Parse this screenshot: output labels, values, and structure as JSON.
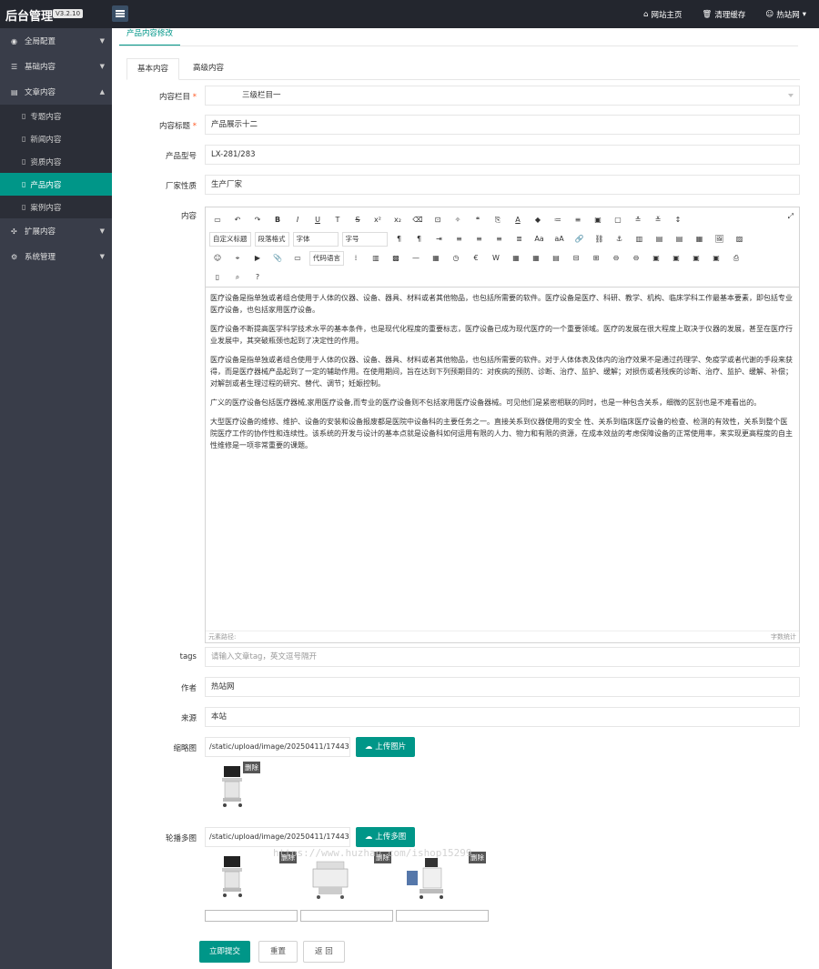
{
  "app": {
    "title": "后台管理",
    "version": "V3.2.10"
  },
  "topnav": {
    "home": "网站主页",
    "clear_cache": "清理缓存",
    "user": "热站网"
  },
  "sidebar": {
    "items": [
      {
        "label": "全局配置"
      },
      {
        "label": "基础内容"
      },
      {
        "label": "文章内容"
      },
      {
        "label": "扩展内容"
      },
      {
        "label": "系统管理"
      }
    ],
    "sub_items": [
      {
        "label": "专题内容"
      },
      {
        "label": "新闻内容"
      },
      {
        "label": "资质内容"
      },
      {
        "label": "产品内容"
      },
      {
        "label": "案例内容"
      }
    ]
  },
  "page_tab": "产品内容修改",
  "tabs": [
    "基本内容",
    "高级内容"
  ],
  "form": {
    "category_label": "内容栏目",
    "category_value": "三级栏目一",
    "title_label": "内容标题",
    "title_value": "产品展示十二",
    "model_label": "产品型号",
    "model_value": "LX-281/283",
    "vendor_label": "厂家性质",
    "vendor_value": "生产厂家",
    "content_label": "内容",
    "tags_label": "tags",
    "tags_placeholder": "请输入文章tag，英文逗号隔开",
    "author_label": "作者",
    "author_value": "热站网",
    "source_label": "来源",
    "source_value": "本站",
    "thumb_label": "缩略图",
    "thumb_value": "/static/upload/image/20250411/174435",
    "upload_image": "上传图片",
    "carousel_label": "轮播多图",
    "carousel_value": "/static/upload/image/20250411/174435",
    "upload_multi": "上传多图",
    "delete": "删除"
  },
  "editor": {
    "dropdowns": {
      "custom_title": "自定义标题",
      "paragraph": "段落格式",
      "font": "字体",
      "size": "字号",
      "code_lang": "代码语言"
    },
    "paragraphs": [
      "医疗设备是指单独或者组合使用于人体的仪器、设备、器具、材料或者其他物品，也包括所需要的软件。医疗设备是医疗、科研、教学、机构、临床学科工作最基本要素，即包括专业医疗设备，也包括家用医疗设备。",
      "医疗设备不断提高医学科学技术水平的基本条件，也是现代化程度的重要标志，医疗设备已成为现代医疗的一个重要领域。医疗的发展在很大程度上取决于仪器的发展，甚至在医疗行业发展中，其突破瓶颈也起到了决定性的作用。",
      "医疗设备是指单独或者组合使用于人体的仪器、设备、器具、材料或者其他物品，也包括所需要的软件。对于人体体表及体内的治疗效果不是通过药理学、免疫学或者代谢的手段来获得，而是医疗器械产品起到了一定的辅助作用。在使用期间，旨在达到下列预期目的：对疾病的预防、诊断、治疗、监护、缓解；对损伤或者残疾的诊断、治疗、监护、缓解、补偿；对解剖或者生理过程的研究、替代、调节；妊娠控制。",
      "广义的医疗设备包括医疗器械,家用医疗设备,而专业的医疗设备则不包括家用医疗设备器械。可见他们是紧密相联的同时，也是一种包含关系，细微的区别也是不难看出的。",
      "大型医疗设备的维修、维护、设备的安装和设备报废都是医院中设备科的主要任务之一。直接关系到仪器使用的安全 性、关系到临床医疗设备的检查、检测的有效性，关系到整个医院医疗工作的协作性和连续性。该系统的开发与设计的基本点就是设备科如何运用有限的人力、物力和有限的资源，在成本效益的考虑保障设备的正常使用率，来实现更高程度的自主性维修是一项非常重要的课题。"
    ],
    "path_label": "元素路径:",
    "word_count": "字数统计"
  },
  "buttons": {
    "submit": "立即提交",
    "reset": "重置",
    "back": "返 回"
  },
  "watermark": "https://www.huzhan.com/ishop15299"
}
